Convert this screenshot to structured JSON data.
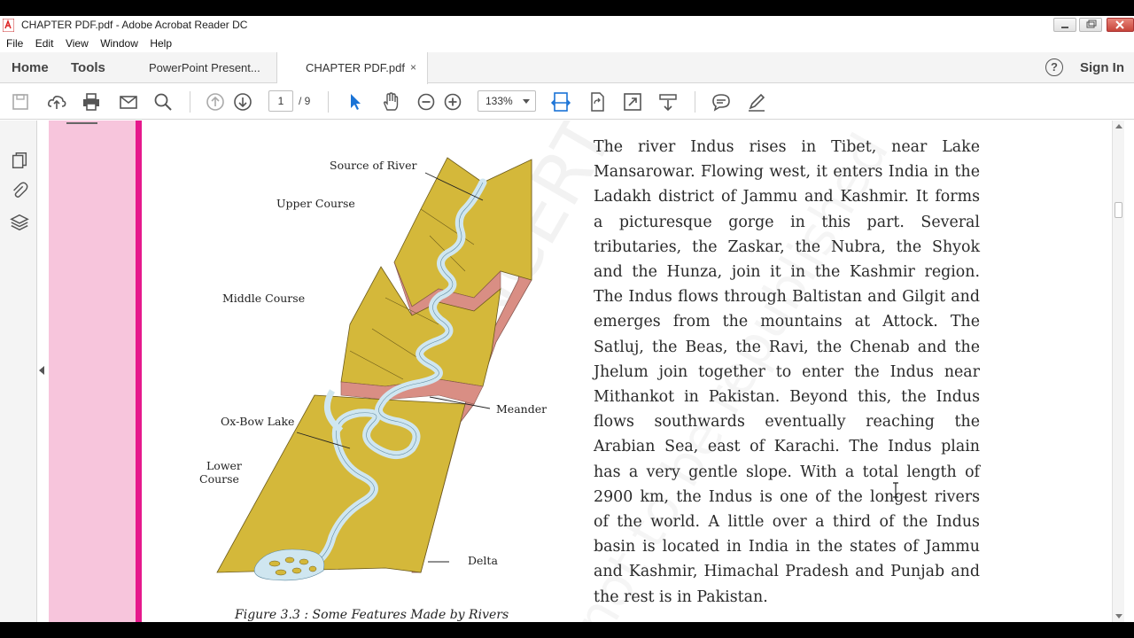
{
  "window": {
    "title": "CHAPTER PDF.pdf - Adobe Acrobat Reader DC"
  },
  "menu": [
    "File",
    "Edit",
    "View",
    "Window",
    "Help"
  ],
  "nav": {
    "home": "Home",
    "tools": "Tools",
    "tabs": [
      {
        "label": "PowerPoint Present..."
      },
      {
        "label": "CHAPTER PDF.pdf",
        "close": "×"
      }
    ],
    "help": "?",
    "signin": "Sign In"
  },
  "toolbar": {
    "page_current": "1",
    "page_total": "/ 9",
    "zoom": "133%"
  },
  "figure": {
    "labels": {
      "source": "Source of River",
      "upper": "Upper Course",
      "middle": "Middle Course",
      "meander": "Meander",
      "oxbow": "Ox-Bow Lake",
      "lower1": "Lower",
      "lower2": "Course",
      "delta": "Delta"
    },
    "caption": "Figure 3.3 : Some Features Made by Rivers"
  },
  "watermark": {
    "line1": "© NCERT",
    "line2": "not to be republished"
  },
  "body_lines": [
    "The river Indus rises in Tibet, near Lake",
    "Mansarowar. Flowing west, it enters India in the",
    "Ladakh district of Jammu and Kashmir. It forms",
    "a picturesque gorge in this part. Several",
    "tributaries, the Zaskar, the Nubra, the Shyok",
    "and the Hunza, join it in the Kashmir region.",
    "The Indus flows through Baltistan and Gilgit and",
    "emerges from the mountains at Attock. The",
    "Satluj, the Beas, the Ravi, the Chenab and the",
    "Jhelum join together to enter the Indus near",
    "Mithankot in Pakistan. Beyond this, the Indus",
    "flows southwards eventually reaching the",
    "Arabian Sea, east of Karachi.  The Indus plain",
    "has a very gentle slope. With a total length of",
    "2900 km, the Indus is one of the longest rivers",
    "of the world. A little over a third of the Indus",
    "basin is located in India in the states of Jammu",
    "and Kashmir, Himachal Pradesh and Punjab and",
    "the rest is in Pakistan."
  ],
  "colors": {
    "land": "#d4b83a",
    "cliff": "#d98e84",
    "river": "#cfe6f0",
    "pink_band": "#f7c5dc",
    "magenta_bar": "#e6198c",
    "cursor_blue": "#1a73d6"
  }
}
